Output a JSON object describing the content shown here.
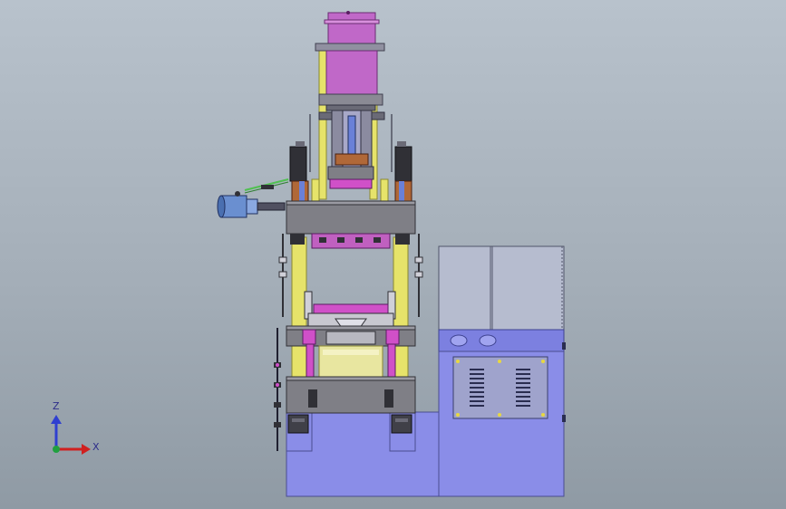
{
  "view": {
    "type": "cad-3d-viewport",
    "background_top": "#b8c2cc",
    "background_bottom": "#8f9aa4"
  },
  "triad": {
    "z_label": "Z",
    "x_label": "X",
    "z_color": "#2f3fd0",
    "x_color": "#d02020",
    "origin_color": "#20a040"
  },
  "colors": {
    "cylinder": "#c068c8",
    "cylinder_dark": "#8a3a96",
    "column": "#e6e36a",
    "column_dark": "#a8a531",
    "crosshead": "#7f7f86",
    "crosshead_dark": "#55555c",
    "base": "#8a8de8",
    "base_dark": "#5b5fb8",
    "cabinet": "#aeb4c8",
    "cabinet_dark": "#6e7488",
    "motor": "#6a8fd0",
    "accent_magenta": "#d050c8",
    "wire_green": "#50c050",
    "copper": "#b06838"
  }
}
